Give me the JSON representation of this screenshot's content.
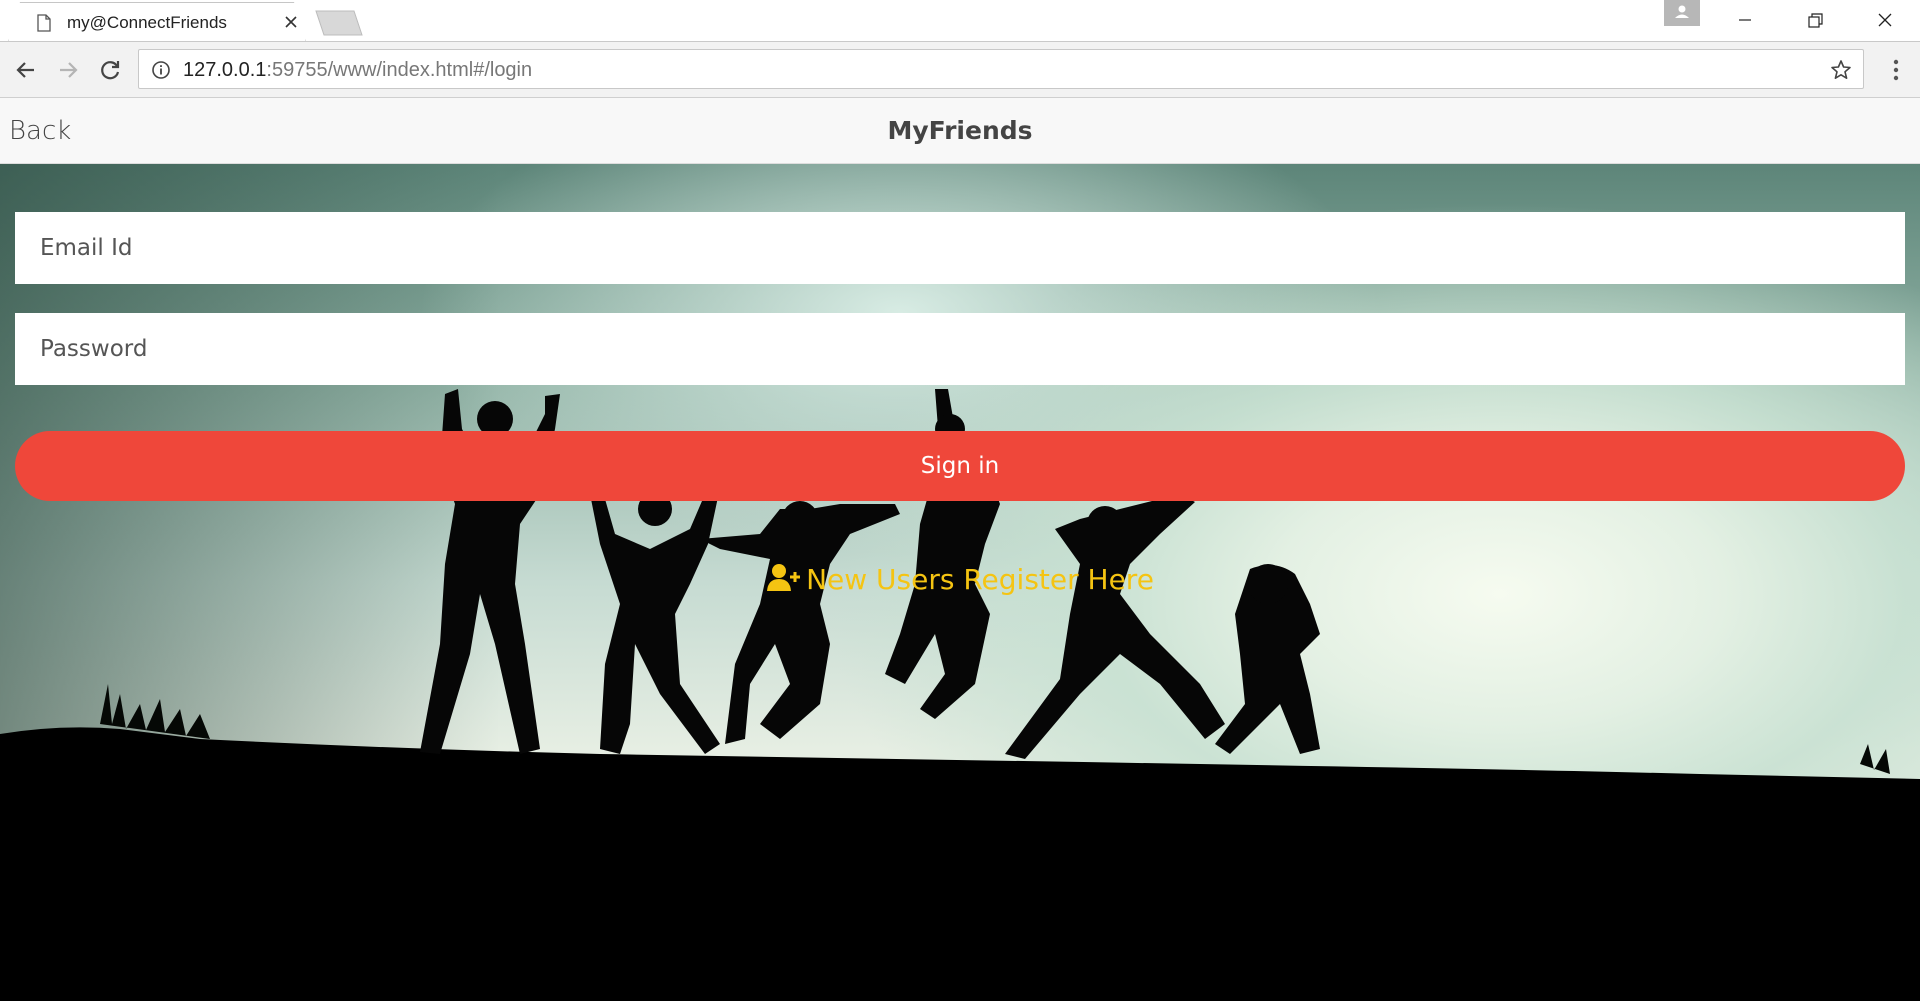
{
  "browser": {
    "tab_title": "my@ConnectFriends",
    "url_host": "127.0.0.1",
    "url_rest": ":59755/www/index.html#/login"
  },
  "app": {
    "back_label": "Back",
    "title": "MyFriends"
  },
  "login": {
    "email_placeholder": "Email Id",
    "password_placeholder": "Password",
    "signin_label": "Sign in",
    "register_label": "New Users Register Here"
  },
  "colors": {
    "signin_button": "#ef473a",
    "register_link": "#f5c412"
  }
}
